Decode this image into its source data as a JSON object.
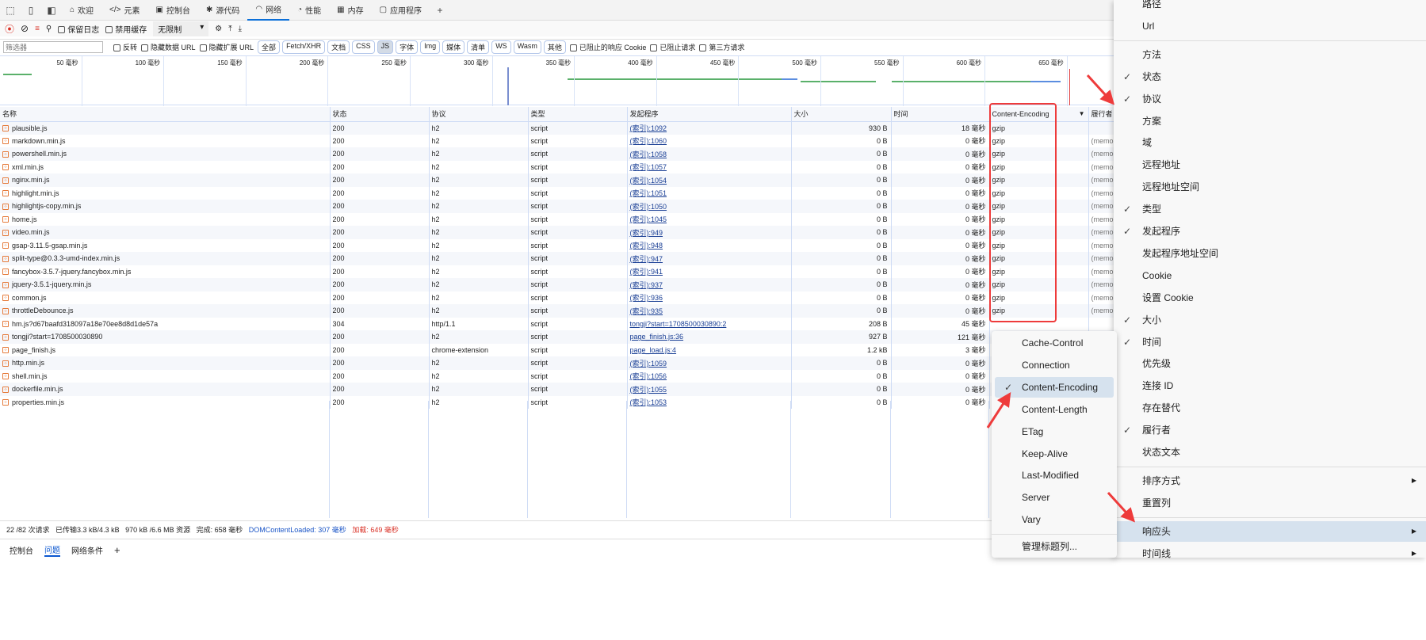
{
  "tabs": [
    {
      "label": "欢迎",
      "icon": "home-icon"
    },
    {
      "label": "元素",
      "icon": "code-icon"
    },
    {
      "label": "控制台",
      "icon": "console-icon"
    },
    {
      "label": "源代码",
      "icon": "bug-icon"
    },
    {
      "label": "网络",
      "icon": "wifi-icon",
      "active": true
    },
    {
      "label": "性能",
      "icon": "gauge-icon"
    },
    {
      "label": "内存",
      "icon": "chip-icon"
    },
    {
      "label": "应用程序",
      "icon": "app-icon"
    }
  ],
  "toolbar": {
    "preserve_log": "保留日志",
    "disable_cache": "禁用缓存",
    "throttle": "无限制"
  },
  "filter": {
    "placeholder": "筛选器",
    "invert": "反转",
    "hide_data_url": "隐藏数据 URL",
    "hide_ext_url": "隐藏扩展 URL",
    "types": [
      "全部",
      "Fetch/XHR",
      "文档",
      "CSS",
      "JS",
      "字体",
      "Img",
      "媒体",
      "清单",
      "WS",
      "Wasm",
      "其他"
    ],
    "active_type": "JS",
    "blocked_cookies": "已阻止的响应 Cookie",
    "blocked_requests": "已阻止请求",
    "third_party": "第三方请求"
  },
  "overview": {
    "ticks": [
      "50 毫秒",
      "100 毫秒",
      "150 毫秒",
      "200 毫秒",
      "250 毫秒",
      "300 毫秒",
      "350 毫秒",
      "400 毫秒",
      "450 毫秒",
      "500 毫秒",
      "550 毫秒",
      "600 毫秒",
      "650 毫秒"
    ]
  },
  "columns": [
    "名称",
    "状态",
    "协议",
    "类型",
    "发起程序",
    "大小",
    "时间",
    "Content-Encoding",
    "履行者"
  ],
  "rows": [
    [
      "plausible.js",
      "200",
      "h2",
      "script",
      "(索引):1092",
      "930 B",
      "18",
      "gzip",
      ""
    ],
    [
      "markdown.min.js",
      "200",
      "h2",
      "script",
      "(索引):1060",
      "0 B",
      "0",
      "gzip",
      "(memo"
    ],
    [
      "powershell.min.js",
      "200",
      "h2",
      "script",
      "(索引):1058",
      "0 B",
      "0",
      "gzip",
      "(memo"
    ],
    [
      "xml.min.js",
      "200",
      "h2",
      "script",
      "(索引):1057",
      "0 B",
      "0",
      "gzip",
      "(memo"
    ],
    [
      "nginx.min.js",
      "200",
      "h2",
      "script",
      "(索引):1054",
      "0 B",
      "0",
      "gzip",
      "(memo"
    ],
    [
      "highlight.min.js",
      "200",
      "h2",
      "script",
      "(索引):1051",
      "0 B",
      "0",
      "gzip",
      "(memo"
    ],
    [
      "highlightjs-copy.min.js",
      "200",
      "h2",
      "script",
      "(索引):1050",
      "0 B",
      "0",
      "gzip",
      "(memo"
    ],
    [
      "home.js",
      "200",
      "h2",
      "script",
      "(索引):1045",
      "0 B",
      "0",
      "gzip",
      "(memo"
    ],
    [
      "video.min.js",
      "200",
      "h2",
      "script",
      "(索引):949",
      "0 B",
      "0",
      "gzip",
      "(memo"
    ],
    [
      "gsap-3.11.5-gsap.min.js",
      "200",
      "h2",
      "script",
      "(索引):948",
      "0 B",
      "0",
      "gzip",
      "(memo"
    ],
    [
      "split-type@0.3.3-umd-index.min.js",
      "200",
      "h2",
      "script",
      "(索引):947",
      "0 B",
      "0",
      "gzip",
      "(memo"
    ],
    [
      "fancybox-3.5.7-jquery.fancybox.min.js",
      "200",
      "h2",
      "script",
      "(索引):941",
      "0 B",
      "0",
      "gzip",
      "(memo"
    ],
    [
      "jquery-3.5.1-jquery.min.js",
      "200",
      "h2",
      "script",
      "(索引):937",
      "0 B",
      "0",
      "gzip",
      "(memo"
    ],
    [
      "common.js",
      "200",
      "h2",
      "script",
      "(索引):936",
      "0 B",
      "0",
      "gzip",
      "(memo"
    ],
    [
      "throttleDebounce.js",
      "200",
      "h2",
      "script",
      "(索引):935",
      "0 B",
      "0",
      "gzip",
      "(memo"
    ],
    [
      "hm.js?d67baafd318097a18e70ee8d8d1de57a",
      "304",
      "http/1.1",
      "script",
      "tongji?start=1708500030890:2",
      "208 B",
      "45",
      "",
      ""
    ],
    [
      "tongji?start=1708500030890",
      "200",
      "h2",
      "script",
      "page_finish.js:36",
      "927 B",
      "121",
      "",
      ""
    ],
    [
      "page_finish.js",
      "200",
      "chrome-extension",
      "script",
      "page_load.js:4",
      "1.2 kB",
      "3",
      "",
      ""
    ],
    [
      "http.min.js",
      "200",
      "h2",
      "script",
      "(索引):1059",
      "0 B",
      "0",
      "",
      ""
    ],
    [
      "shell.min.js",
      "200",
      "h2",
      "script",
      "(索引):1056",
      "0 B",
      "0",
      "",
      ""
    ],
    [
      "dockerfile.min.js",
      "200",
      "h2",
      "script",
      "(索引):1055",
      "0 B",
      "0",
      "",
      ""
    ],
    [
      "properties.min.js",
      "200",
      "h2",
      "script",
      "(索引):1053",
      "0 B",
      "0",
      "",
      ""
    ]
  ],
  "time_unit": "毫秒",
  "status": {
    "requests": "22 /82 次请求",
    "transferred": "已传输3.3 kB/4.3 kB",
    "resources": "970 kB /6.6 MB 资源",
    "finish": "完成: 658 毫秒",
    "dcl_label": "DOMContentLoaded: 307",
    "dcl_unit": "毫秒",
    "load_label": "加载: 649",
    "load_unit": "毫秒"
  },
  "drawer": {
    "tabs": [
      "控制台",
      "问题",
      "网络条件"
    ]
  },
  "menu": {
    "items": [
      {
        "label": "路径",
        "checked": false
      },
      {
        "label": "Url",
        "checked": false
      },
      {
        "sep": true
      },
      {
        "label": "方法",
        "checked": false
      },
      {
        "label": "状态",
        "checked": true
      },
      {
        "label": "协议",
        "checked": true
      },
      {
        "label": "方案",
        "checked": false
      },
      {
        "label": "域",
        "checked": false
      },
      {
        "label": "远程地址",
        "checked": false
      },
      {
        "label": "远程地址空间",
        "checked": false
      },
      {
        "label": "类型",
        "checked": true
      },
      {
        "label": "发起程序",
        "checked": true
      },
      {
        "label": "发起程序地址空间",
        "checked": false
      },
      {
        "label": "Cookie",
        "checked": false
      },
      {
        "label": "设置 Cookie",
        "checked": false
      },
      {
        "label": "大小",
        "checked": true
      },
      {
        "label": "时间",
        "checked": true
      },
      {
        "label": "优先级",
        "checked": false
      },
      {
        "label": "连接 ID",
        "checked": false
      },
      {
        "label": "存在替代",
        "checked": false
      },
      {
        "label": "履行者",
        "checked": true
      },
      {
        "label": "状态文本",
        "checked": false
      },
      {
        "sep": true
      },
      {
        "label": "排序方式",
        "submenu": true
      },
      {
        "label": "重置列"
      },
      {
        "sep": true
      },
      {
        "label": "响应头",
        "submenu": true,
        "highlighted": true
      },
      {
        "label": "时间线",
        "submenu": true
      }
    ]
  },
  "submenu": {
    "items": [
      {
        "label": "Cache-Control"
      },
      {
        "label": "Connection"
      },
      {
        "label": "Content-Encoding",
        "checked": true,
        "highlighted": true
      },
      {
        "label": "Content-Length"
      },
      {
        "label": "ETag"
      },
      {
        "label": "Keep-Alive"
      },
      {
        "label": "Last-Modified"
      },
      {
        "label": "Server"
      },
      {
        "label": "Vary"
      },
      {
        "sep": true
      },
      {
        "label": "管理标题列..."
      }
    ]
  }
}
